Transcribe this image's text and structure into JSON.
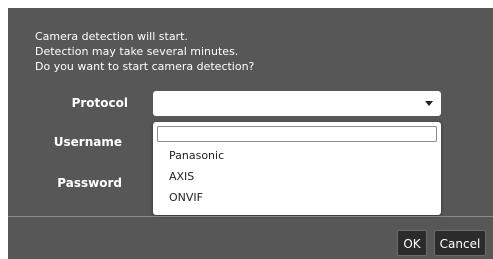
{
  "message": {
    "line1": "Camera detection will start.",
    "line2": "Detection may take several minutes.",
    "line3": "Do you want to start camera detection?"
  },
  "form": {
    "protocol_label": "Protocol",
    "protocol_value": "",
    "username_label": "Username",
    "password_label": "Password"
  },
  "dropdown": {
    "search_value": "",
    "options": [
      "Panasonic",
      "AXIS",
      "ONVIF"
    ]
  },
  "buttons": {
    "ok": "OK",
    "cancel": "Cancel"
  },
  "icons": {
    "dropdown_caret": "chevron-down-icon"
  },
  "colors": {
    "dialog_bg": "#575757",
    "button_bg": "#2b2b2b"
  }
}
